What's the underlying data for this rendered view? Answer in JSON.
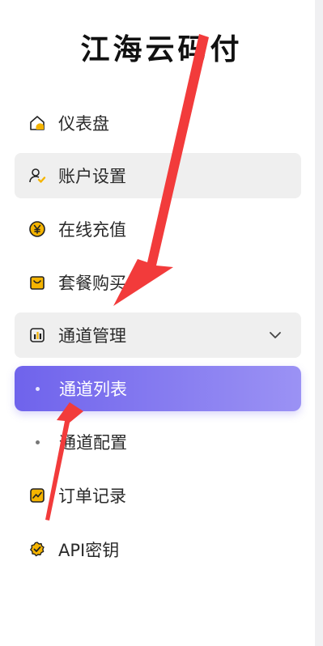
{
  "brand": {
    "title": "江海云码付"
  },
  "menu": [
    {
      "label": "仪表盘",
      "icon": "dashboard-icon"
    },
    {
      "label": "账户设置",
      "icon": "user-settings-icon"
    },
    {
      "label": "在线充值",
      "icon": "yen-coin-icon"
    },
    {
      "label": "套餐购买",
      "icon": "package-icon"
    },
    {
      "label": "通道管理",
      "icon": "channel-chart-icon",
      "expanded": true,
      "children": [
        {
          "label": "通道列表",
          "active": true
        },
        {
          "label": "通道配置",
          "active": false
        }
      ]
    },
    {
      "label": "订单记录",
      "icon": "order-chart-icon"
    },
    {
      "label": "API密钥",
      "icon": "api-key-icon"
    }
  ],
  "colors": {
    "accent_start": "#6f63ec",
    "accent_end": "#9b92f4",
    "icon_yellow": "#f5b400",
    "annotation_arrow": "#f23b3b"
  }
}
